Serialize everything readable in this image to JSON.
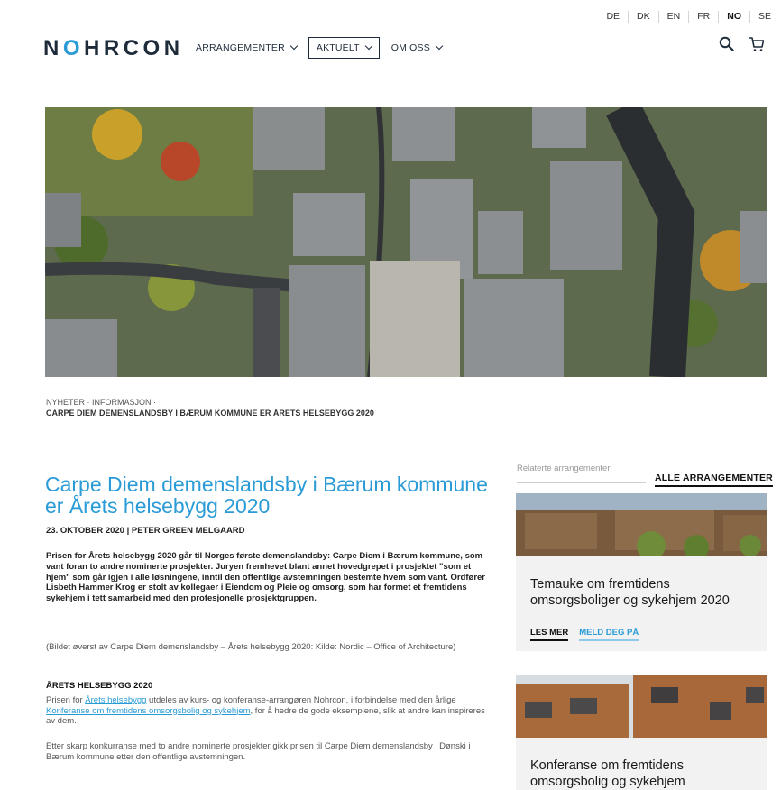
{
  "languages": [
    "DE",
    "DK",
    "EN",
    "FR",
    "NO",
    "SE"
  ],
  "active_language": "NO",
  "logo": {
    "text": "NOHRCON"
  },
  "nav": {
    "items": [
      {
        "label": "ARRANGEMENTER"
      },
      {
        "label": "AKTUELT"
      },
      {
        "label": "OM OSS"
      }
    ]
  },
  "icons": {
    "search": "search-icon",
    "cart": "cart-icon"
  },
  "breadcrumb": {
    "line1": "NYHETER · INFORMASJON ·",
    "current": "CARPE DIEM DEMENSLANDSBY I BÆRUM KOMMUNE ER ÅRETS HELSEBYGG 2020"
  },
  "article": {
    "title": "Carpe Diem demenslandsby i Bærum kommune er Årets helsebygg 2020",
    "date": "23. OKTOBER 2020",
    "author": "PETER GREEN MELGAARD",
    "separator": "|",
    "lead": "Prisen for Årets helsebygg 2020 går til Norges første demenslandsby: Carpe Diem i Bærum kommune, som vant foran to andre nominerte prosjekter. Juryen fremhevet blant annet hovedgrepet i prosjektet \"som et hjem\" som går igjen i alle løsningene, inntil den offentlige avstemningen bestemte hvem som vant. Ordfører Lisbeth Hammer Krog er stolt av kollegaer i Eiendom og Pleie og omsorg, som har formet et fremtidens sykehjem i tett samarbeid med den profesjonelle prosjektgruppen.",
    "caption": "(Bildet øverst av Carpe Diem demenslandsby – Årets helsebygg 2020: Kilde: Nordic – Office of Architecture)",
    "section_heading": "ÅRETS HELSEBYGG 2020",
    "p1_a": "Prisen for ",
    "p1_link1": "Årets helsebygg",
    "p1_b": " utdeles av kurs- og konferanse-arrangøren Nohrcon, i forbindelse med den årlige ",
    "p1_link2": "Konferanse om fremtidens omsorgsbolig og sykehjem",
    "p1_c": ", for å hedre de gode eksemplene, slik at andre kan inspireres av dem.",
    "p2": "Etter skarp konkurranse med to andre nominerte prosjekter gikk prisen til Carpe Diem demenslandsby i Dønski i Bærum kommune etter den offentlige avstemningen."
  },
  "sidebar": {
    "select_placeholder": "Relaterte arrangementer",
    "all_events": "ALLE ARRANGEMENTER",
    "cards": [
      {
        "title": "Temauke om fremtidens omsorgsboliger og sykehjem 2020",
        "read_more": "LES MER",
        "register": "MELD DEG PÅ"
      },
      {
        "title": "Konferanse om fremtidens omsorgsbolig og sykehjem"
      }
    ]
  },
  "colors": {
    "accent": "#2a9bd6",
    "dark": "#1d2b3a",
    "card_bg": "#f2f2f2"
  }
}
